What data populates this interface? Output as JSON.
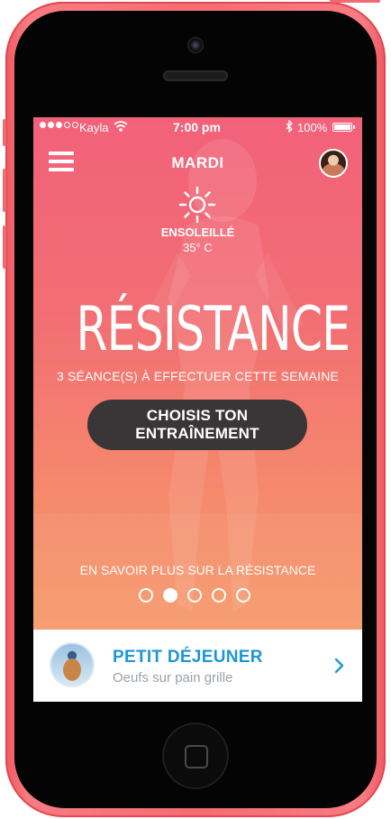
{
  "status_bar": {
    "carrier": "Kayla",
    "time": "7:00 pm",
    "battery": "100%"
  },
  "header": {
    "day": "MARDI"
  },
  "weather": {
    "condition": "ENSOLEILLÉ",
    "temperature": "35° C",
    "icon": "sun-icon"
  },
  "hero": {
    "title": "RÉSISTANCE",
    "subtitle": "3 SÉANCE(S) À EFFECTUER CETTE SEMAINE",
    "cta_label": "CHOISIS TON ENTRAÎNEMENT",
    "more_label": "EN SAVOIR PLUS SUR LA RÉSISTANCE"
  },
  "pager": {
    "count": 5,
    "active_index": 1
  },
  "meal": {
    "title": "PETIT DÉJEUNER",
    "description": "Oeufs sur pain grille"
  },
  "colors": {
    "gradient_top": "#f2617a",
    "gradient_bottom": "#f6a16a",
    "button_dark": "#3a3537",
    "meal_accent": "#1e96d6",
    "phone_body": "#f56c73"
  }
}
